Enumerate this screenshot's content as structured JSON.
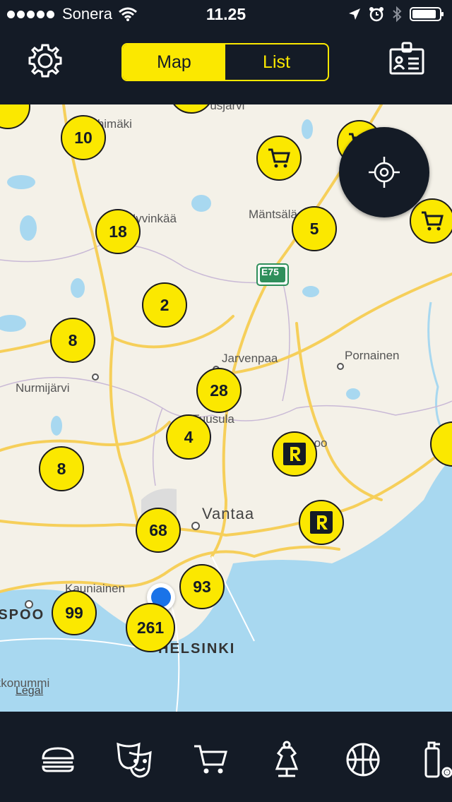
{
  "status_bar": {
    "carrier": "Sonera",
    "time": "11.25"
  },
  "nav": {
    "tabs": [
      {
        "label": "Map",
        "active": true
      },
      {
        "label": "List",
        "active": false
      }
    ]
  },
  "map": {
    "labels": {
      "riihimaki": "Riihimäki",
      "hyvinkaa": "Hyvinkää",
      "mantsala": "Mäntsälä",
      "jarvenpaa": "Jarvenpaa",
      "pornainen": "Pornainen",
      "nurmijarvi": "Nurmijärvi",
      "tuusula": "Tuusula",
      "sipoo": "Sipoo",
      "vantaa": "Vantaa",
      "kauniainen": "Kauniainen",
      "espoo": "ESPOO",
      "helsinki": "HELSINKI",
      "kirkkonummi": "Kirkkonummi",
      "highway": "E75",
      "pusjarvi": "Pusjärvi"
    },
    "clusters": {
      "c10": "10",
      "c18": "18",
      "c5": "5",
      "c2": "2",
      "c8a": "8",
      "c28": "28",
      "c4": "4",
      "c8b": "8",
      "c68": "68",
      "c93": "93",
      "c99": "99",
      "c261": "261"
    },
    "legal": "Legal"
  },
  "colors": {
    "accent": "#fbe800",
    "dark": "#141b26",
    "water": "#a8d8f0",
    "road": "#f6cf5a",
    "user_location": "#1a73e8"
  },
  "tabbar": {
    "icons": [
      "burger-icon",
      "theater-masks-icon",
      "shopping-cart-icon",
      "dress-icon",
      "basketball-icon",
      "cosmetics-icon"
    ]
  }
}
